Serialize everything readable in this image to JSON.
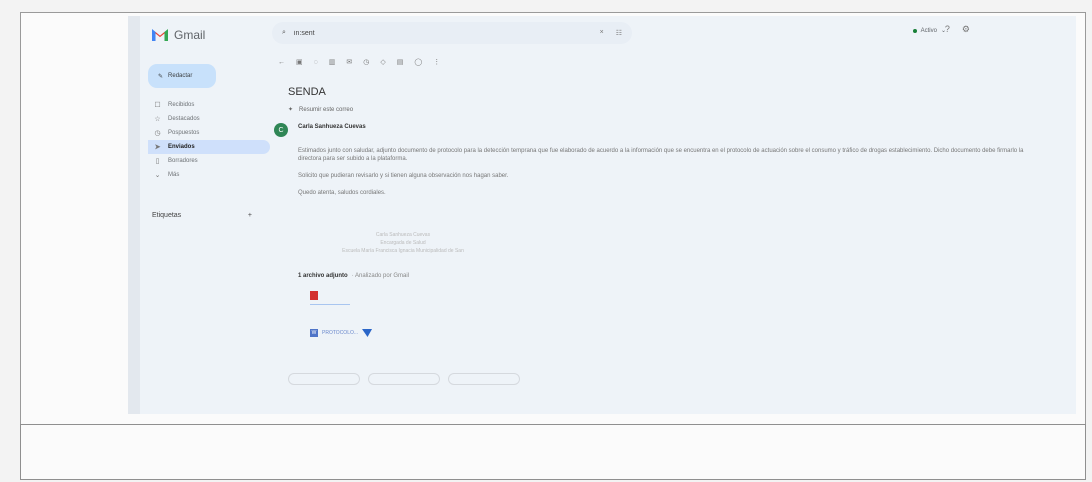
{
  "app": {
    "name": "Gmail"
  },
  "search": {
    "value": "in:sent"
  },
  "status": {
    "label": "Activo"
  },
  "sidebar": {
    "compose": "Redactar",
    "items": [
      {
        "label": "Recibidos"
      },
      {
        "label": "Destacados"
      },
      {
        "label": "Pospuestos"
      },
      {
        "label": "Enviados"
      },
      {
        "label": "Borradores"
      },
      {
        "label": "Más"
      }
    ],
    "labels_heading": "Etiquetas"
  },
  "email": {
    "subject": "SENDA",
    "summary": "Resumir este correo",
    "sender": "Carla Sanhueza Cuevas",
    "avatar_letter": "C",
    "paragraph_1": "Estimados junto con saludar, adjunto documento de protocolo para la detección temprana que fue elaborado de acuerdo a la información que se encuentra en el protocolo de actuación sobre el consumo y tráfico de drogas establecimiento. Dicho documento debe firmarlo la directora para ser subido a la plataforma.",
    "paragraph_2": "Solicito que pudieran revisarlo y si tienen alguna observación nos hagan saber.",
    "paragraph_3": "Quedo atenta, saludos cordiales.",
    "signature_line_1": "Carla Sanhueza Cuevas",
    "signature_line_2": "Encargada de Salud",
    "signature_line_3": "Escuela María Francisca Ignacia Municipalidad de San",
    "attachments_title": "1 archivo adjunto",
    "attachments_note": "· Analizado por Gmail",
    "attachment_name": "PROTOCOLO..."
  }
}
